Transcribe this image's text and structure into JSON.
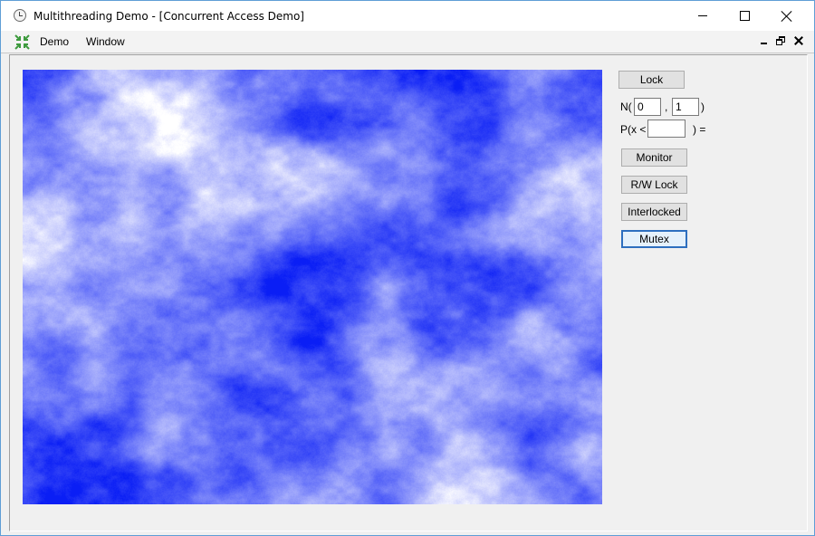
{
  "window": {
    "title": "Multithreading Demo - [Concurrent Access Demo]"
  },
  "menu": {
    "items": [
      "Demo",
      "Window"
    ]
  },
  "controls": {
    "lock_button": "Lock",
    "normal_prefix": "N(",
    "mean_value": "0",
    "comma": ",",
    "stddev_value": "1",
    "normal_suffix": ")",
    "prob_prefix": "P(x <",
    "prob_value": "",
    "prob_suffix": ") =",
    "monitor_button": "Monitor",
    "rwlock_button": "R/W Lock",
    "interlocked_button": "Interlocked",
    "mutex_button": "Mutex"
  },
  "colors": {
    "noise_dark": "#0a1ef5",
    "noise_light": "#ffffff",
    "focus_border": "#2e6fbf"
  },
  "icons": {
    "app": "clock-icon",
    "mdi_child": "arrows-in-icon"
  }
}
